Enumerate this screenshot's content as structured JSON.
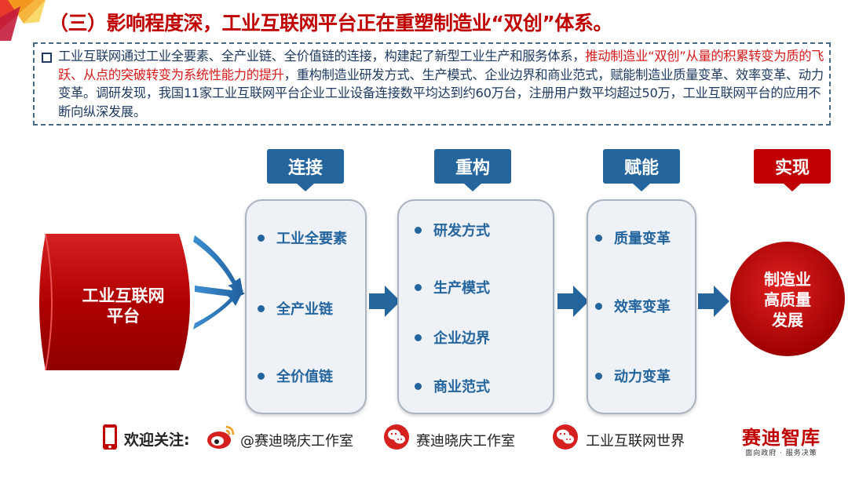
{
  "title": "（三）影响程度深，工业互联网平台正在重塑制造业“双创”体系。",
  "intro": {
    "part1": "工业互联网通过工业全要素、全产业链、全价值链的连接，构建起了新型工业生产和服务体系，",
    "highlight": "推动制造业“双创”从量的积累转变为质的飞跃、从点的突破转变为系统性能力的提升",
    "part2": "，重构制造业研发方式、生产模式、企业边界和商业范式，赋能制造业质量变革、效率变革、动力变革。调研发现，我国11家工业互联网平台企业工业设备连接数平均达到约60万台，注册用户数平均超过50万，工业互联网平台的应用不断向纵深发展。"
  },
  "platform": {
    "line1": "工业互联网",
    "line2": "平台"
  },
  "columns": [
    {
      "header": "连接",
      "items": [
        "工业全要素",
        "全产业链",
        "全价值链"
      ]
    },
    {
      "header": "重构",
      "items": [
        "研发方式",
        "生产模式",
        "企业边界",
        "商业范式"
      ]
    },
    {
      "header": "赋能",
      "items": [
        "质量变革",
        "效率变革",
        "动力变革"
      ]
    },
    {
      "header": "实现"
    }
  ],
  "outcome": {
    "line1": "制造业",
    "line2": "高质量",
    "line3": "发展"
  },
  "footer": {
    "follow_label": "欢迎关注:",
    "weibo": "@赛迪晓庆工作室",
    "wechat1": "赛迪晓庆工作室",
    "wechat2": "工业互联网世界",
    "brand": "赛迪智库",
    "brand_sub": "面向政府 · 服务决策"
  },
  "colors": {
    "red": "#c00000",
    "blue": "#24659e",
    "text": "#1f3b63"
  }
}
